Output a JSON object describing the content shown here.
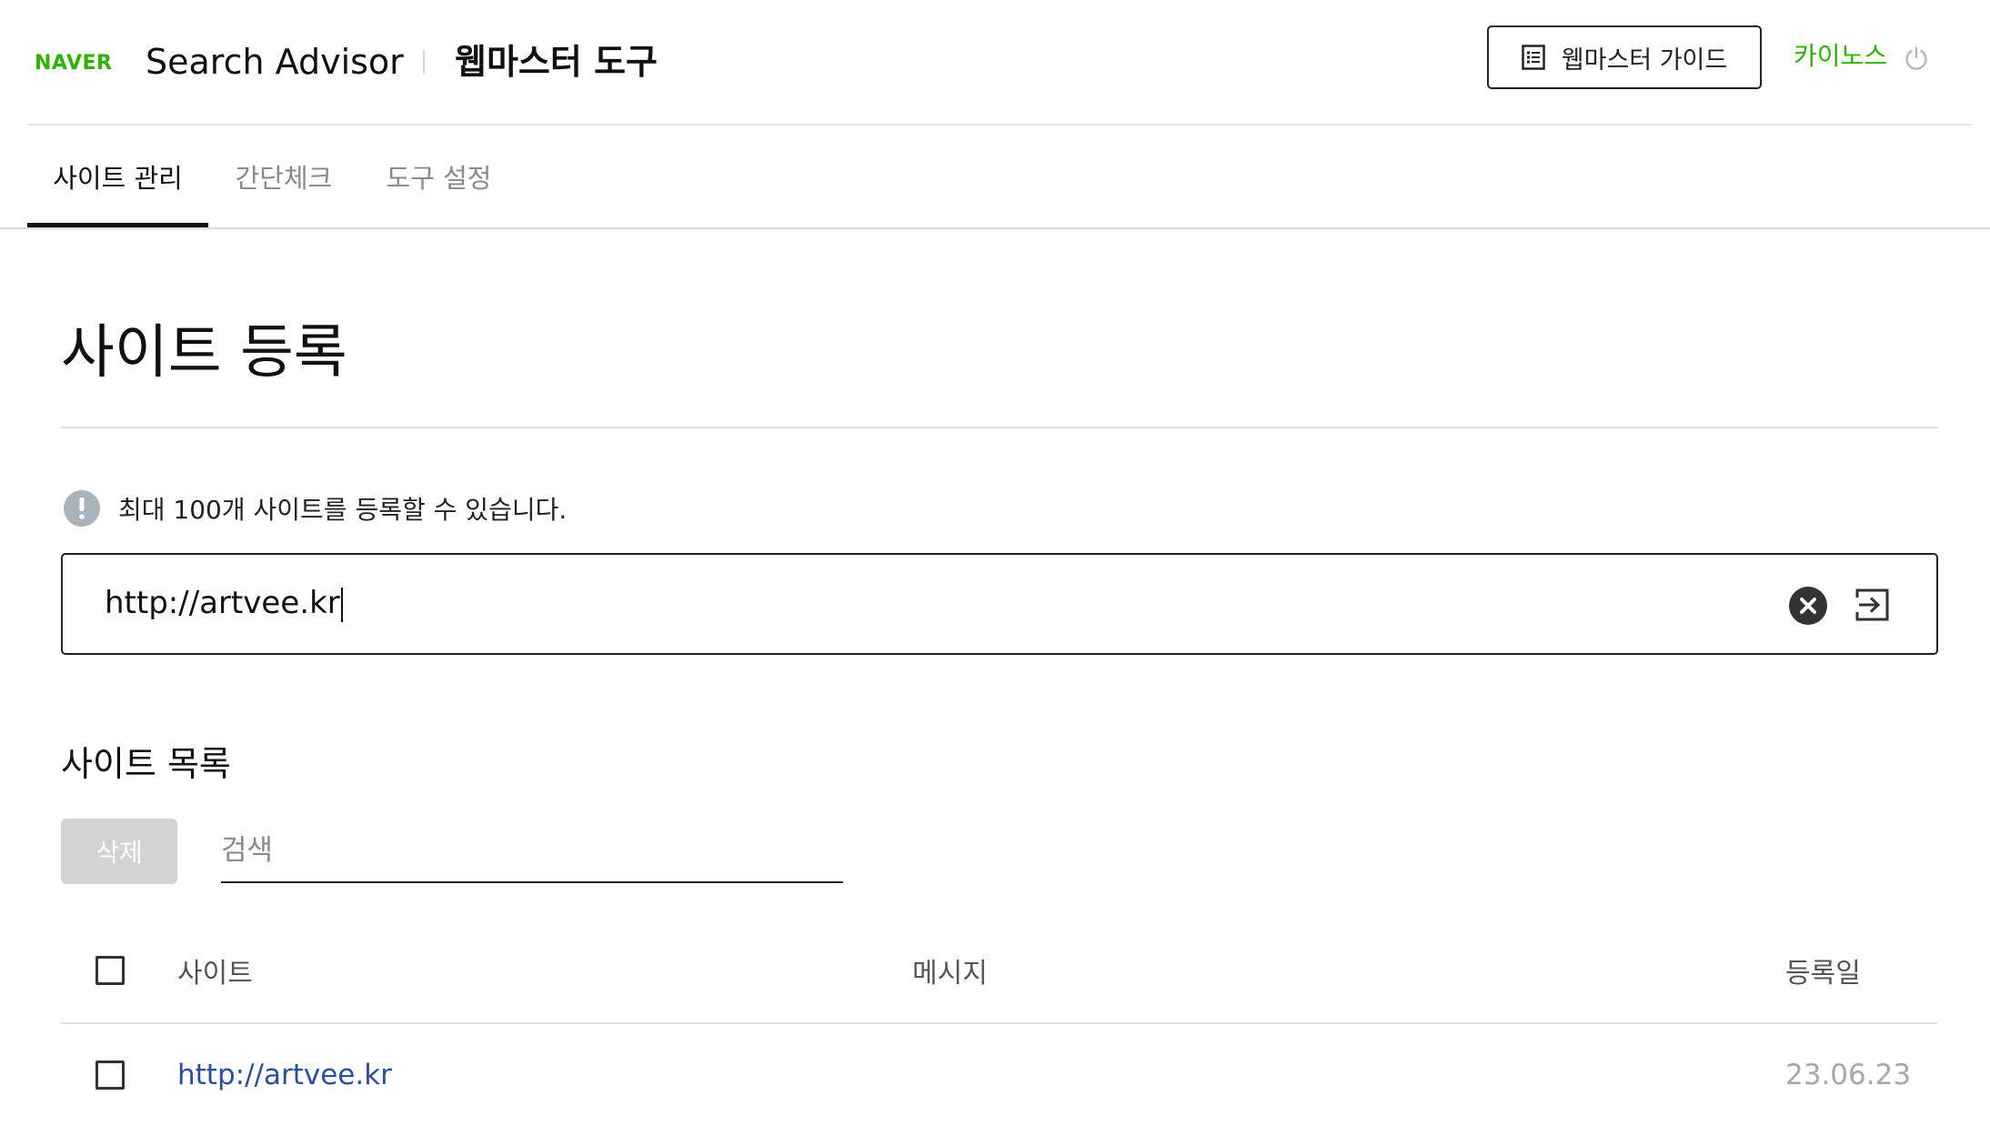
{
  "header": {
    "brand": "NAVER",
    "app_title": "Search Advisor",
    "tool_title": "웹마스터 도구",
    "guide_button_label": "웹마스터 가이드",
    "user_name": "카이노스",
    "brand_color": "#2db400"
  },
  "tabs": [
    {
      "label": "사이트 관리",
      "active": true
    },
    {
      "label": "간단체크",
      "active": false
    },
    {
      "label": "도구 설정",
      "active": false
    }
  ],
  "main": {
    "heading": "사이트 등록",
    "info_text": "최대 100개 사이트를 등록할 수 있습니다.",
    "url_input_value": "http://artvee.kr",
    "list_heading": "사이트 목록",
    "delete_button_label": "삭제",
    "search_placeholder": "검색"
  },
  "table": {
    "columns": [
      "사이트",
      "메시지",
      "등록일"
    ],
    "rows": [
      {
        "site": "http://artvee.kr",
        "message": "",
        "date": "23.06.23",
        "checked": false
      }
    ]
  },
  "icons": {
    "guide": "document-list-icon",
    "logout": "power-icon",
    "info": "info-icon",
    "clear": "clear-icon",
    "submit": "submit-arrow-icon"
  },
  "colors": {
    "accent_green": "#2db400",
    "link_blue": "#2a4f9e",
    "disabled_button": "#d3d3d3"
  }
}
